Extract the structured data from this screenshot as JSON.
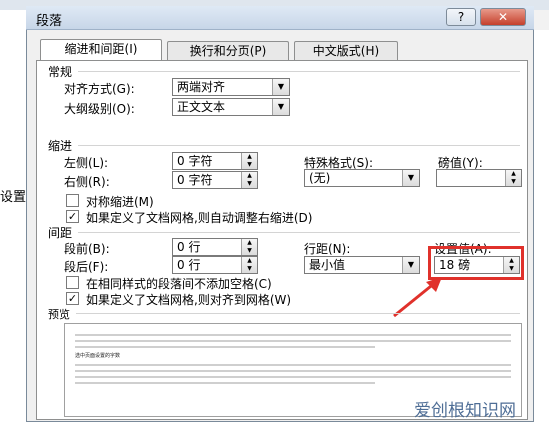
{
  "dialog": {
    "title": "段落",
    "help_label": "?",
    "close_label": "✕"
  },
  "background": {
    "left_fragment": "设置"
  },
  "tabs": [
    {
      "label": "缩进和间距(I)",
      "active": true
    },
    {
      "label": "换行和分页(P)",
      "active": false
    },
    {
      "label": "中文版式(H)",
      "active": false
    }
  ],
  "general": {
    "heading": "常规",
    "alignment_label": "对齐方式(G):",
    "alignment_value": "两端对齐",
    "outline_label": "大纲级别(O):",
    "outline_value": "正文文本"
  },
  "indent": {
    "heading": "缩进",
    "left_label": "左侧(L):",
    "left_value": "0 字符",
    "right_label": "右侧(R):",
    "right_value": "0 字符",
    "special_label": "特殊格式(S):",
    "special_value": "(无)",
    "by_label": "磅值(Y):",
    "by_value": "",
    "mirror_label": "对称缩进(M)",
    "mirror_checked": false,
    "auto_adjust_label": "如果定义了文档网格,则自动调整右缩进(D)",
    "auto_adjust_checked": true
  },
  "spacing": {
    "heading": "间距",
    "before_label": "段前(B):",
    "before_value": "0 行",
    "after_label": "段后(F):",
    "after_value": "0 行",
    "line_label": "行距(N):",
    "line_value": "最小值",
    "at_label": "设置值(A):",
    "at_value": "18 磅",
    "no_space_label": "在相同样式的段落间不添加空格(C)",
    "no_space_checked": false,
    "snap_grid_label": "如果定义了文档网格,则对齐到网格(W)",
    "snap_grid_checked": true
  },
  "preview": {
    "heading": "预览",
    "sample_text": "选中页面设置的字数"
  },
  "annotation": {
    "highlight_color": "#e0312b"
  },
  "watermark": {
    "text": "爱创根知识网"
  },
  "icons": {
    "checkmark": "✓",
    "dropdown": "▼",
    "spin_up": "▲",
    "spin_down": "▼"
  }
}
